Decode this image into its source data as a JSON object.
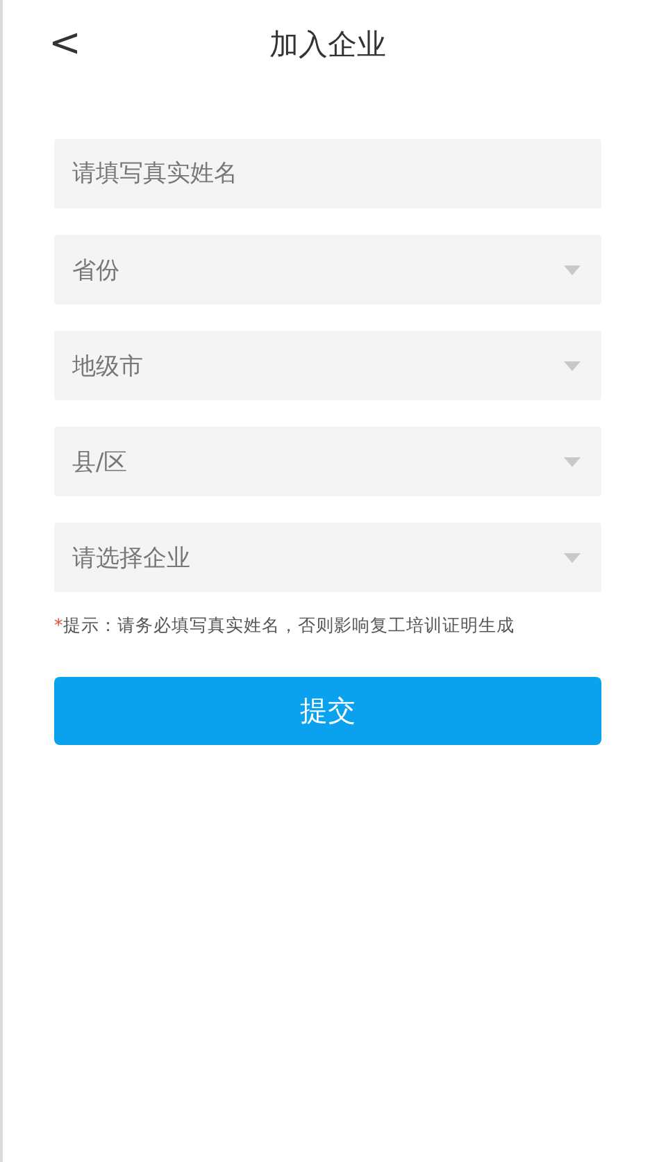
{
  "header": {
    "back": "<",
    "title": "加入企业"
  },
  "fields": [
    {
      "kind": "input",
      "placeholder": "请填写真实姓名"
    },
    {
      "kind": "select",
      "placeholder": "省份"
    },
    {
      "kind": "select",
      "placeholder": "地级市"
    },
    {
      "kind": "select",
      "placeholder": "县/区"
    },
    {
      "kind": "select",
      "placeholder": "请选择企业"
    }
  ],
  "hint": {
    "mark": "*",
    "text": "提示：请务必填写真实姓名，否则影响复工培训证明生成"
  },
  "submit": "提交"
}
